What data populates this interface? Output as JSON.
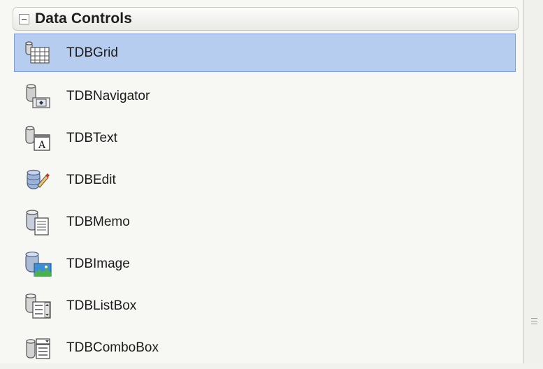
{
  "palette": {
    "group_title": "Data Controls",
    "items": [
      {
        "label": "TDBGrid",
        "icon": "db-grid-icon",
        "selected": true
      },
      {
        "label": "TDBNavigator",
        "icon": "db-navigator-icon",
        "selected": false
      },
      {
        "label": "TDBText",
        "icon": "db-text-icon",
        "selected": false
      },
      {
        "label": "TDBEdit",
        "icon": "db-edit-icon",
        "selected": false
      },
      {
        "label": "TDBMemo",
        "icon": "db-memo-icon",
        "selected": false
      },
      {
        "label": "TDBImage",
        "icon": "db-image-icon",
        "selected": false
      },
      {
        "label": "TDBListBox",
        "icon": "db-listbox-icon",
        "selected": false
      },
      {
        "label": "TDBComboBox",
        "icon": "db-combobox-icon",
        "selected": false
      }
    ]
  },
  "colors": {
    "selection_fill": "#b7cdf0",
    "selection_border": "#7f9ed8"
  }
}
